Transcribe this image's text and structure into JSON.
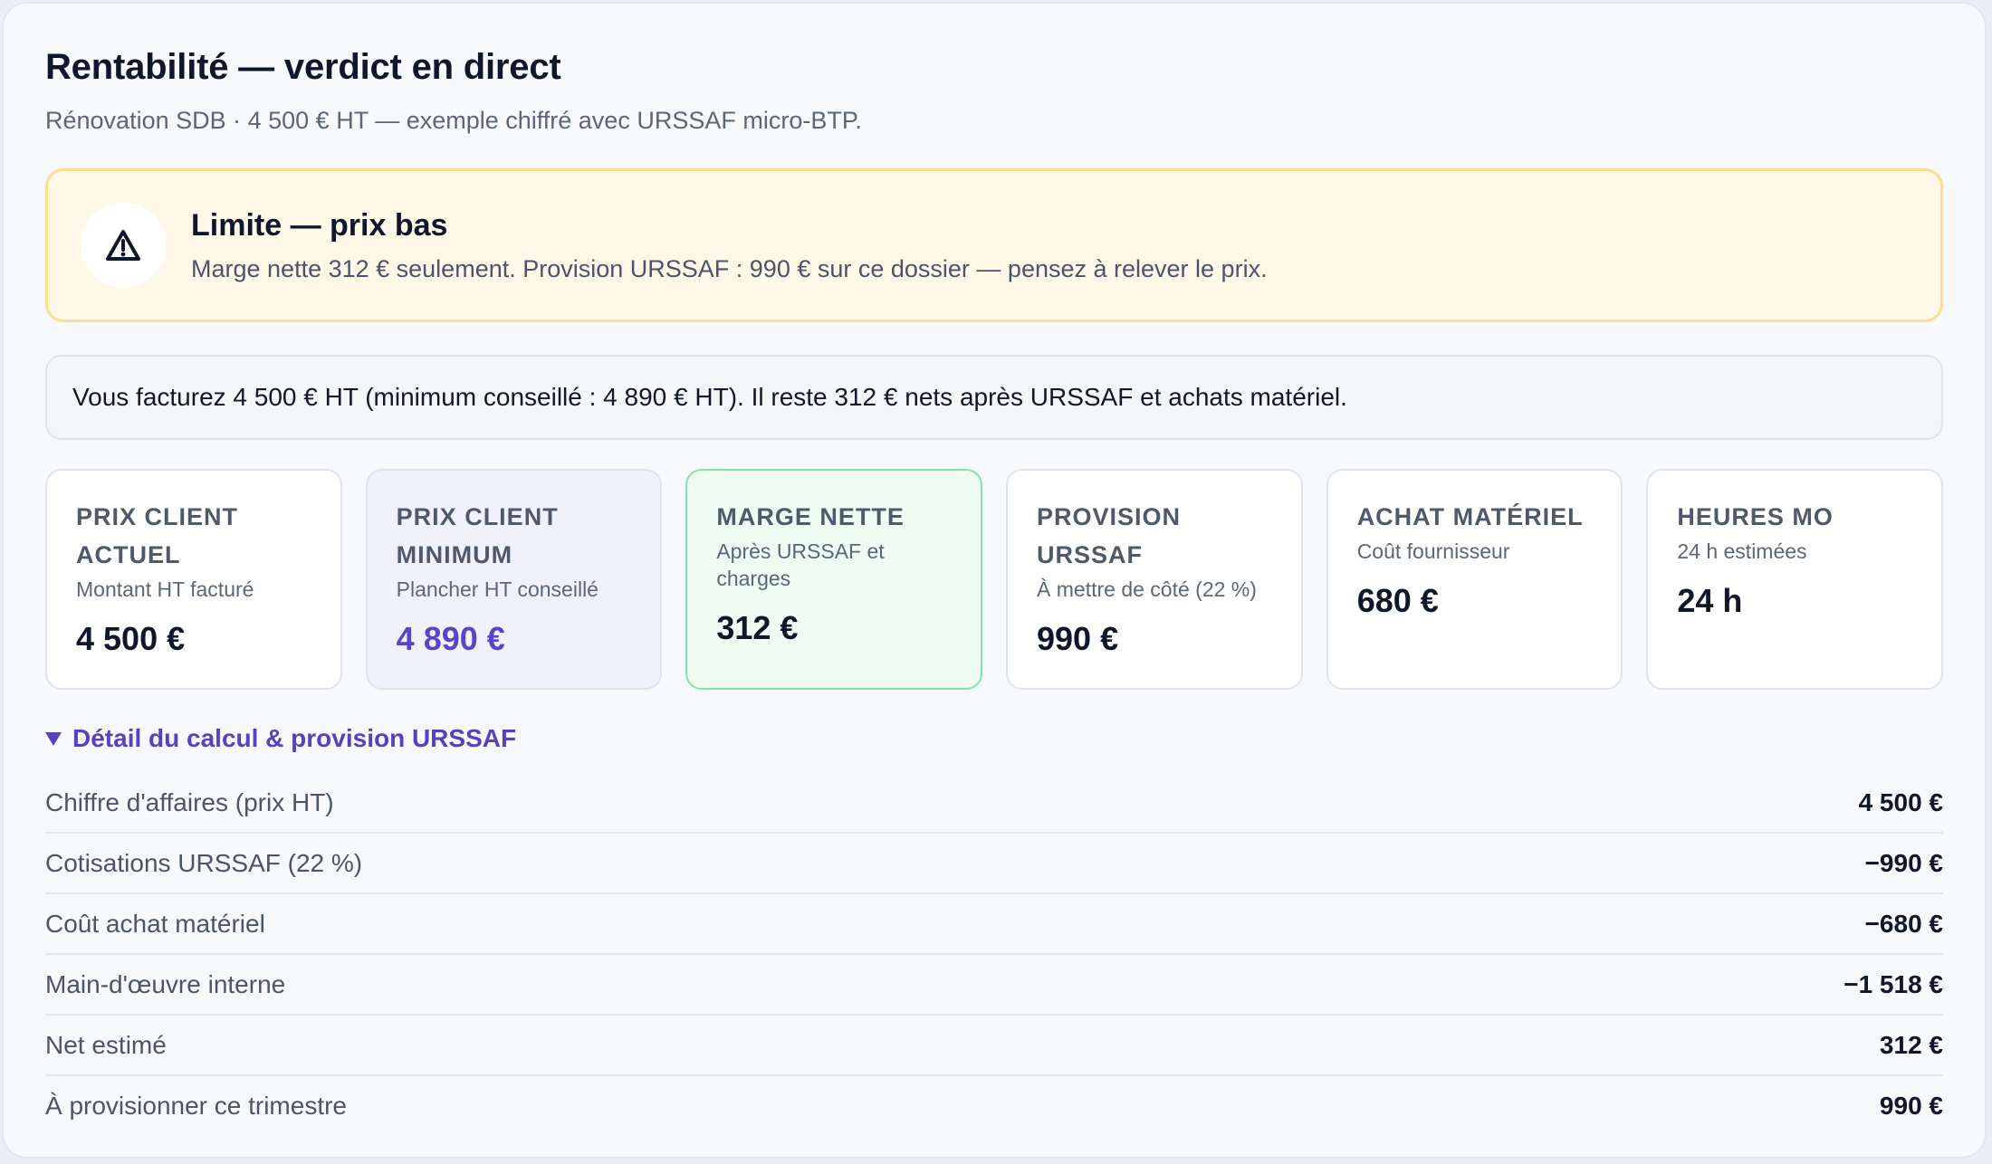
{
  "header": {
    "title": "Rentabilité — verdict en direct",
    "subtitle": "Rénovation SDB · 4 500 € HT — exemple chiffré avec URSSAF micro-BTP."
  },
  "alert": {
    "icon": "warning-triangle-icon",
    "title": "Limite — prix bas",
    "body": "Marge nette 312 € seulement. Provision URSSAF : 990 € sur ce dossier — pensez à relever le prix.",
    "background": "#fff7e8",
    "border": "#fadf8e"
  },
  "summary": {
    "text": "Vous facturez 4 500 € HT (minimum conseillé : 4 890 € HT). Il reste 312 € nets après URSSAF et achats matériel."
  },
  "cards": [
    {
      "label": "Prix client actuel",
      "sub": "Montant HT facturé",
      "value": "4 500 €"
    },
    {
      "label": "Prix client minimum",
      "sub": "Plancher HT conseillé",
      "value": "4 890 €"
    },
    {
      "label": "Marge nette",
      "sub": "Après URSSAF et charges",
      "value": "312 €"
    },
    {
      "label": "Provision URSSAF",
      "sub": "À mettre de côté (22 %)",
      "value": "990 €"
    },
    {
      "label": "Achat matériel",
      "sub": "Coût fournisseur",
      "value": "680 €"
    },
    {
      "label": "Heures MO",
      "sub": "24 h estimées",
      "value": "24 h"
    }
  ],
  "details": {
    "toggle_label": "Détail du calcul & provision URSSAF",
    "expanded": true,
    "rows": [
      {
        "label": "Chiffre d'affaires (prix HT)",
        "value": "4 500 €"
      },
      {
        "label": "Cotisations URSSAF (22 %)",
        "value": "−990 €"
      },
      {
        "label": "Coût achat matériel",
        "value": "−680 €"
      },
      {
        "label": "Main-d'œuvre interne",
        "value": "−1 518 €"
      },
      {
        "label": "Net estimé",
        "value": "312 €"
      },
      {
        "label": "À provisionner ce trimestre",
        "value": "990 €"
      }
    ]
  },
  "colors": {
    "accent": "#5a3fc0",
    "minimum_value": "#5a45c6",
    "net_card_border": "#86e3a8",
    "net_card_bg": "#effcf4"
  }
}
